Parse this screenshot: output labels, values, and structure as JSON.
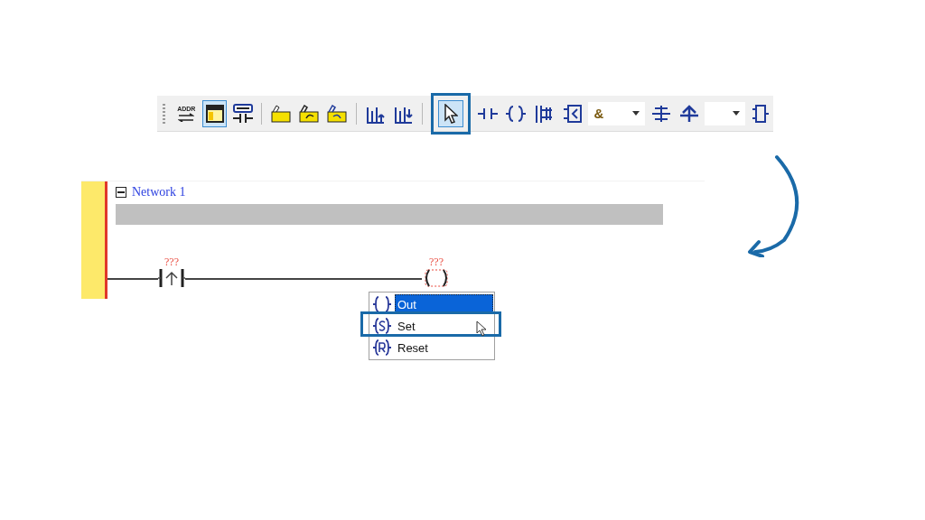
{
  "toolbar": {
    "items": [
      {
        "kind": "button",
        "label": "ADDR",
        "selected": false,
        "callout": false
      },
      {
        "kind": "button",
        "selected": true,
        "callout": false
      },
      {
        "kind": "button",
        "selected": false,
        "callout": false
      },
      {
        "kind": "separator"
      },
      {
        "kind": "button",
        "selected": false,
        "callout": false
      },
      {
        "kind": "button",
        "selected": false,
        "callout": false
      },
      {
        "kind": "button",
        "selected": false,
        "callout": false
      },
      {
        "kind": "separator"
      },
      {
        "kind": "button",
        "selected": false,
        "callout": false
      },
      {
        "kind": "button",
        "selected": false,
        "callout": false
      },
      {
        "kind": "separator"
      },
      {
        "kind": "button",
        "selected": true,
        "callout": true
      },
      {
        "kind": "button",
        "selected": false,
        "callout": false
      },
      {
        "kind": "button",
        "selected": false,
        "callout": false
      },
      {
        "kind": "button",
        "selected": false,
        "callout": false
      },
      {
        "kind": "button",
        "selected": false,
        "callout": false
      },
      {
        "kind": "dropdown",
        "value": "&"
      },
      {
        "kind": "button",
        "selected": false,
        "callout": false
      },
      {
        "kind": "button",
        "selected": false,
        "callout": false
      },
      {
        "kind": "dropdown"
      },
      {
        "kind": "button",
        "selected": false,
        "callout": false
      }
    ]
  },
  "network": {
    "title": "Network 1",
    "expanded": true,
    "contact": {
      "label": "???"
    },
    "coil": {
      "label": "???"
    },
    "menu": [
      {
        "label": "Out",
        "selected": true,
        "callout": false
      },
      {
        "label": "Set",
        "selected": false,
        "callout": true
      },
      {
        "label": "Reset",
        "selected": false,
        "callout": false
      }
    ]
  }
}
